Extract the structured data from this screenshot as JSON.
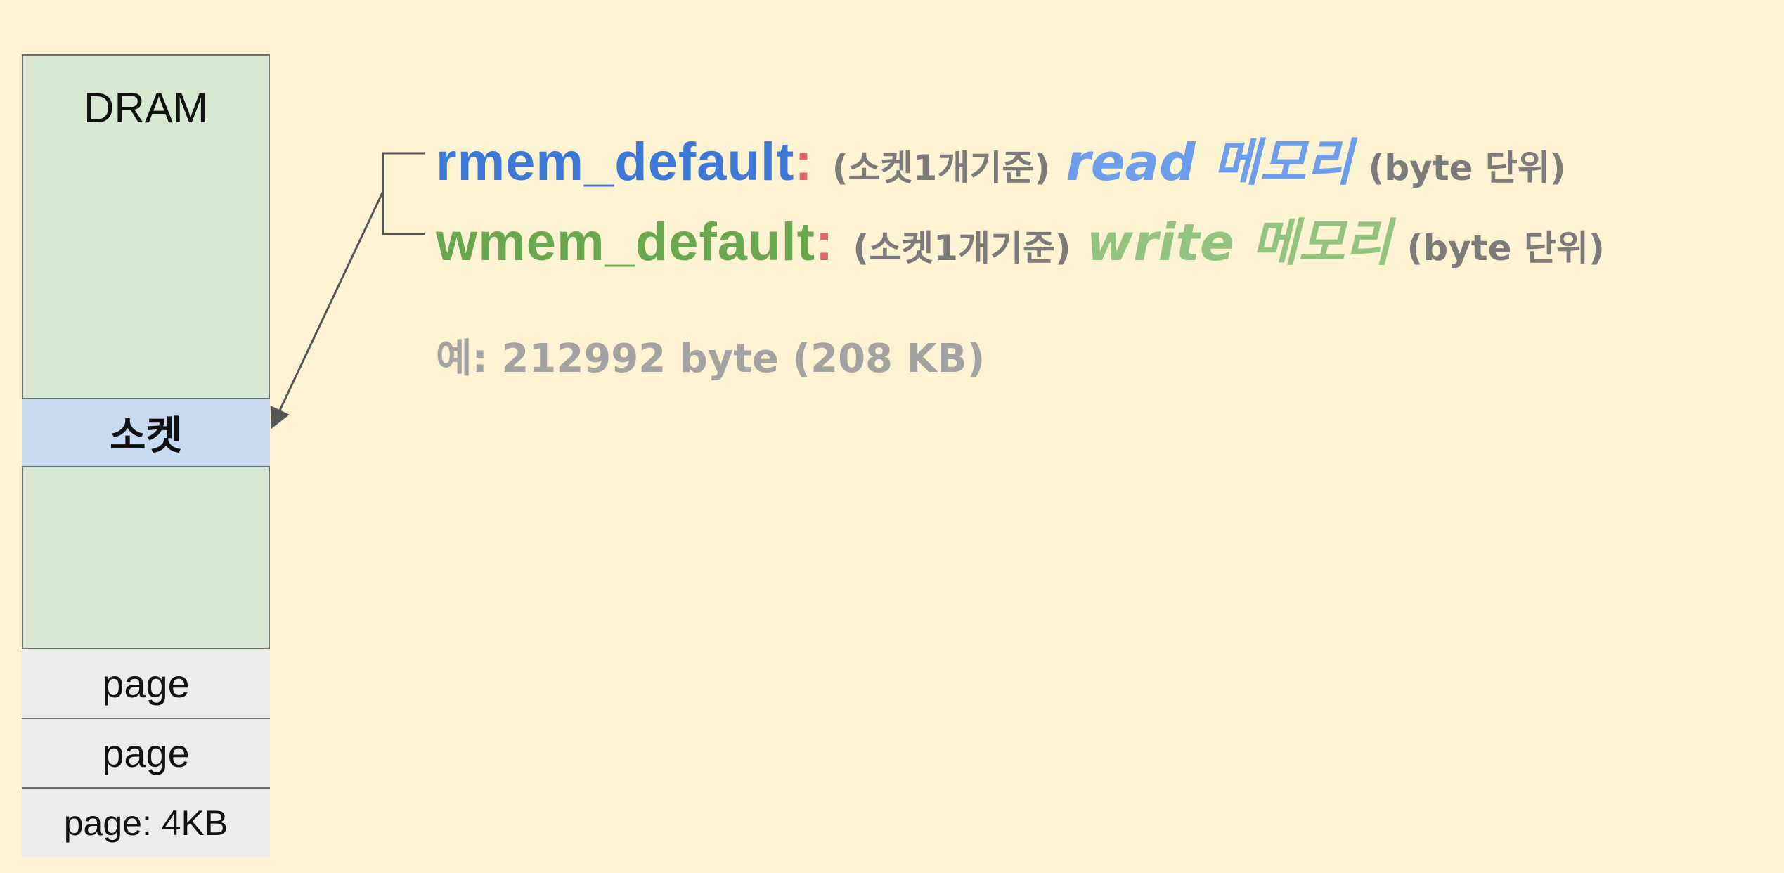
{
  "memory_column": {
    "dram_label": "DRAM",
    "socket_label": "소켓",
    "pages": [
      "page",
      "page"
    ],
    "page_size_label": "page: 4KB"
  },
  "parameters": [
    {
      "name": "rmem_default",
      "colon": ":",
      "scope": "(소켓1개기준)",
      "memory_type": "read 메모리",
      "unit": "(byte 단위)"
    },
    {
      "name": "wmem_default",
      "colon": ":",
      "scope": "(소켓1개기준)",
      "memory_type": "write 메모리",
      "unit": "(byte 단위)"
    }
  ],
  "example": "예: 212992 byte (208 KB)",
  "colors": {
    "background": "#fdf2d2",
    "dram_fill": "#d9e8d3",
    "socket_fill": "#c6daf0",
    "page_fill": "#ececea",
    "rmem_name": "#3c78d8",
    "rmem_type": "#6d9eeb",
    "wmem_name": "#6aa84f",
    "wmem_type": "#93c47d",
    "colon": "#e06666",
    "annotation_gray": "#7b7b7b",
    "example_gray": "#a3a3a3"
  }
}
